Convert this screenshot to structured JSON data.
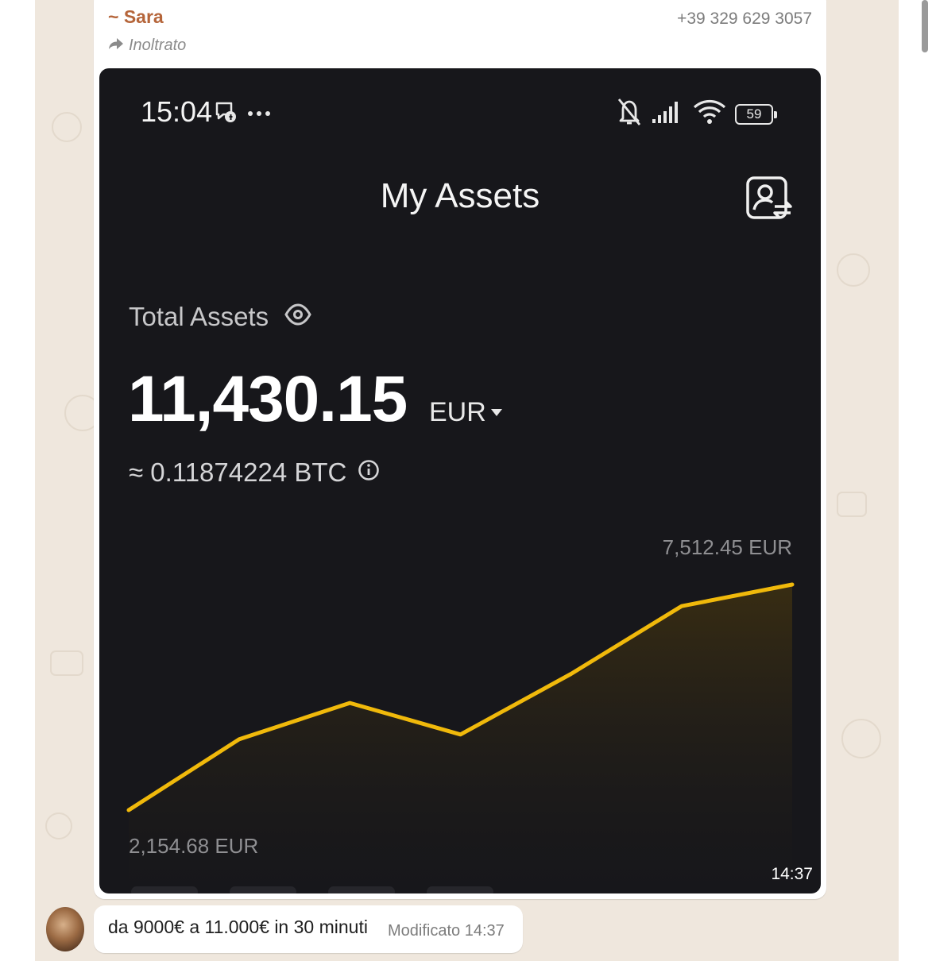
{
  "chat": {
    "sender_name": "~ Sara",
    "sender_phone": "+39 329 629 3057",
    "forwarded_label": "Inoltrato",
    "image_time": "14:37",
    "reply": {
      "text": "da 9000€ a 11.000€ in 30 minuti",
      "meta": "Modificato  14:37"
    }
  },
  "screenshot": {
    "status_bar": {
      "time": "15:04",
      "battery": "59"
    },
    "title": "My Assets",
    "total_label": "Total Assets",
    "total_value": "11,430.15",
    "currency": "EUR",
    "btc_equivalent": "≈ 0.11874224 BTC",
    "accent_color": "#f0b90b"
  },
  "chart_data": {
    "type": "line",
    "max_label": "7,512.45 EUR",
    "min_label": "2,154.68 EUR",
    "x": [
      0,
      1,
      2,
      3,
      4,
      5,
      6
    ],
    "values": [
      2154.68,
      3840,
      4700,
      3950,
      5390,
      7000,
      7512.45
    ],
    "ylim": [
      2154.68,
      7512.45
    ],
    "fill": "area"
  },
  "icons": [
    "eye-icon",
    "info-icon",
    "forward-arrow-icon",
    "account-switch-icon",
    "muted-bell-icon",
    "signal-icon",
    "wifi-icon",
    "battery-icon",
    "messenger-icon",
    "more-dots-icon",
    "currency-caret-icon"
  ]
}
